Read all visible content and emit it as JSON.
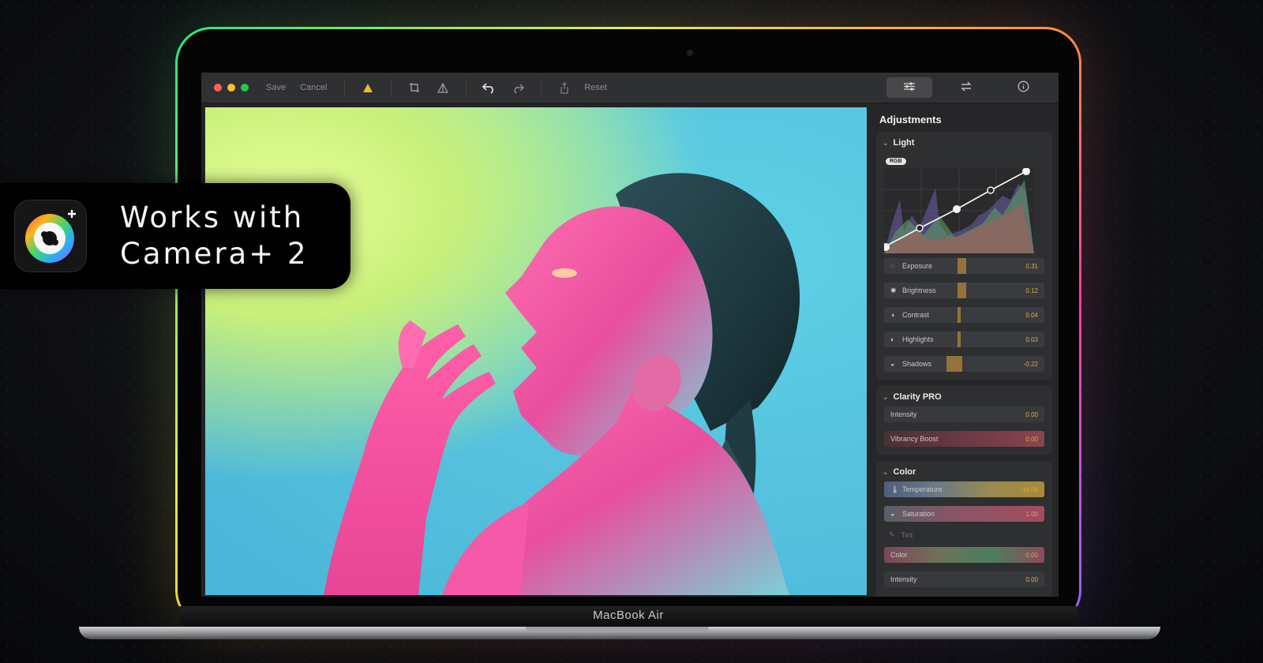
{
  "badge": {
    "text": "Works with\nCamera+ 2"
  },
  "laptop": {
    "model": "MacBook Air"
  },
  "toolbar": {
    "save_label": "Save",
    "cancel_label": "Cancel",
    "reset_label": "Reset"
  },
  "panel": {
    "title": "Adjustments",
    "light": {
      "title": "Light",
      "rgb_badge": "RGB",
      "sliders": [
        {
          "icon": "exposure-icon",
          "label": "Exposure",
          "value": "0.31",
          "level": 0.5
        },
        {
          "icon": "brightness-icon",
          "label": "Brightness",
          "value": "0.12",
          "level": 0.5
        },
        {
          "icon": "contrast-icon",
          "label": "Contrast",
          "value": "0.04",
          "level": 0.5
        },
        {
          "icon": "highlights-icon",
          "label": "Highlights",
          "value": "0.03",
          "level": 0.5
        },
        {
          "icon": "shadows-icon",
          "label": "Shadows",
          "value": "-0.22",
          "level": 0.5
        }
      ]
    },
    "clarity": {
      "title": "Clarity PRO",
      "sliders": [
        {
          "label": "Intensity",
          "value": "0.00"
        },
        {
          "label": "Vibrancy Boost",
          "value": "0.00"
        }
      ]
    },
    "color": {
      "title": "Color",
      "sliders": [
        {
          "label": "Temperature",
          "value": "-16.08"
        },
        {
          "label": "Saturation",
          "value": "1.00"
        }
      ],
      "tint_label": "Tint",
      "sliders2": [
        {
          "label": "Color",
          "value": "0.00"
        },
        {
          "label": "Intensity",
          "value": "0.00"
        }
      ]
    }
  },
  "colors": {
    "accent_gold": "#d9a94a",
    "close": "#ff5f57",
    "minimize": "#febc2e",
    "zoom": "#28c840"
  }
}
